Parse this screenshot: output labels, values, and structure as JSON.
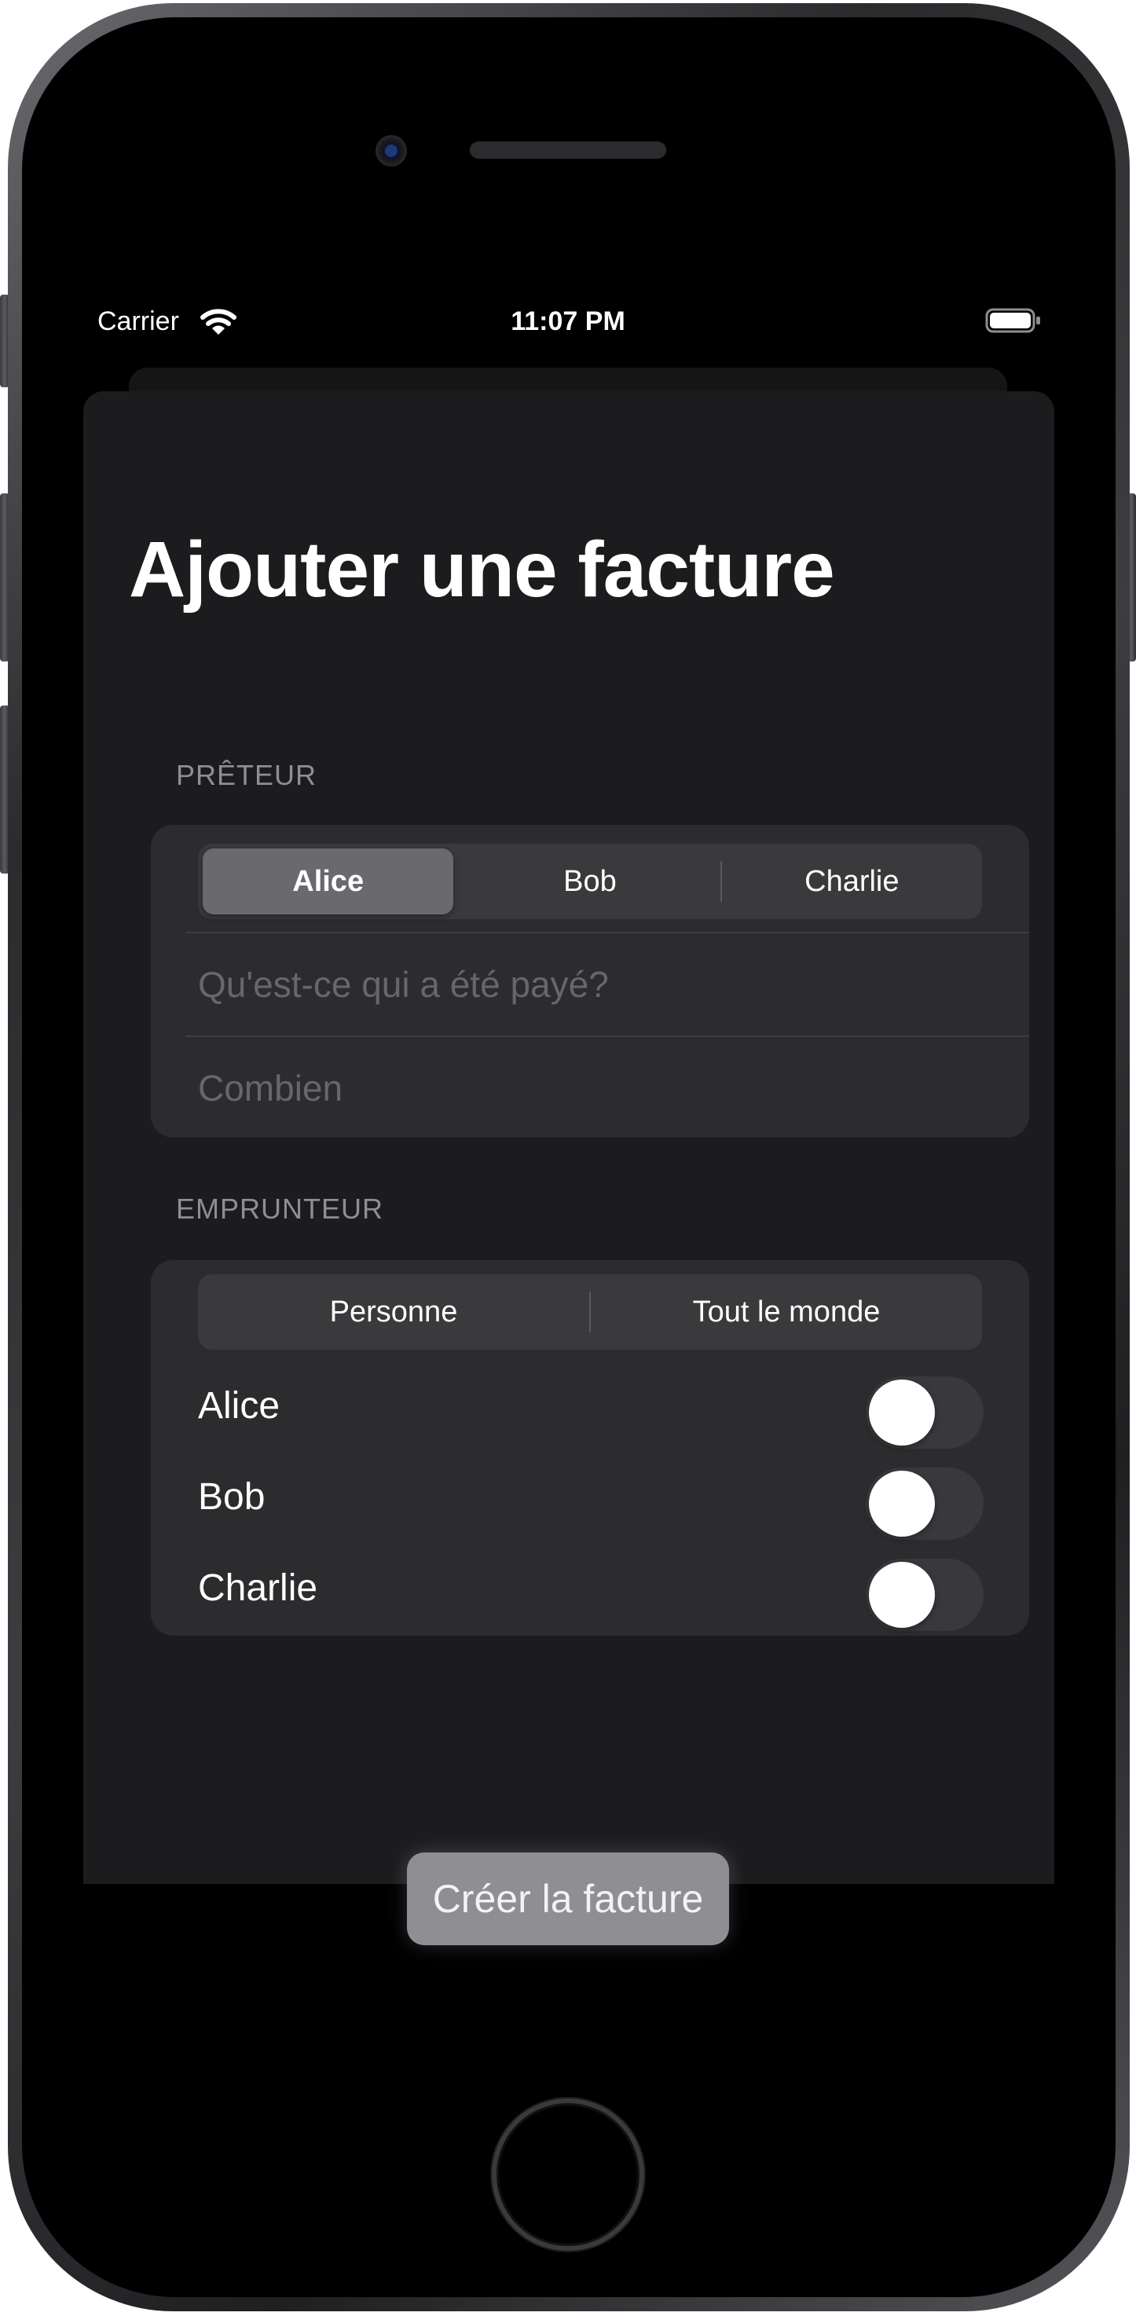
{
  "status_bar": {
    "carrier": "Carrier",
    "time": "11:07 PM",
    "wifi_icon": "wifi-icon",
    "battery_icon": "battery-icon"
  },
  "title": "Ajouter une facture",
  "lender_section": {
    "header": "PRÊTEUR",
    "segments": [
      "Alice",
      "Bob",
      "Charlie"
    ],
    "selected": "Alice",
    "description_placeholder": "Qu'est-ce qui a été payé?",
    "amount_placeholder": "Combien"
  },
  "borrower_section": {
    "header": "EMPRUNTEUR",
    "segments": [
      "Personne",
      "Tout le monde"
    ],
    "people": [
      {
        "name": "Alice",
        "on": false
      },
      {
        "name": "Bob",
        "on": false
      },
      {
        "name": "Charlie",
        "on": false
      }
    ]
  },
  "create_button": "Créer la facture",
  "colors": {
    "background": "#000000",
    "sheet": "#1c1c1e",
    "group": "#2c2c2e",
    "segment_selected": "#69696e",
    "button": "#8e8e93"
  }
}
